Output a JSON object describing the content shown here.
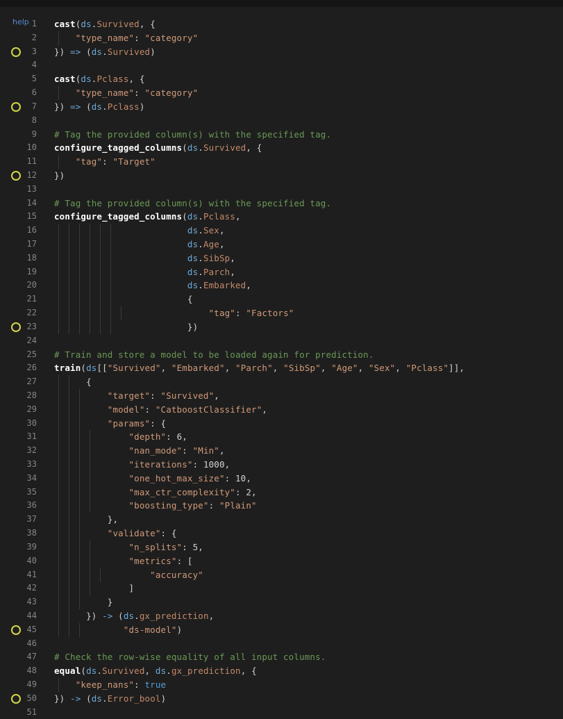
{
  "editor": {
    "help_label": "help",
    "lines": [
      {
        "n": "1",
        "bp": false,
        "t": [
          [
            "f",
            "cast"
          ],
          [
            "o",
            "("
          ],
          [
            "d",
            "ds"
          ],
          [
            "o",
            "."
          ],
          [
            "a",
            "Survived"
          ],
          [
            "o",
            ", {"
          ]
        ]
      },
      {
        "n": "2",
        "bp": false,
        "i": "    ",
        "g": [
          76
        ],
        "t": [
          [
            "k",
            "\"type_name\""
          ],
          [
            "o",
            ": "
          ],
          [
            "s",
            "\"category\""
          ]
        ]
      },
      {
        "n": "3",
        "bp": true,
        "t": [
          [
            "o",
            "}) "
          ],
          [
            "d",
            "=>"
          ],
          [
            "o",
            " ("
          ],
          [
            "d",
            "ds"
          ],
          [
            "o",
            "."
          ],
          [
            "a",
            "Survived"
          ],
          [
            "o",
            ")"
          ]
        ]
      },
      {
        "n": "4",
        "bp": false,
        "t": []
      },
      {
        "n": "5",
        "bp": false,
        "t": [
          [
            "f",
            "cast"
          ],
          [
            "o",
            "("
          ],
          [
            "d",
            "ds"
          ],
          [
            "o",
            "."
          ],
          [
            "a",
            "Pclass"
          ],
          [
            "o",
            ", {"
          ]
        ]
      },
      {
        "n": "6",
        "bp": false,
        "i": "    ",
        "g": [
          76
        ],
        "t": [
          [
            "k",
            "\"type_name\""
          ],
          [
            "o",
            ": "
          ],
          [
            "s",
            "\"category\""
          ]
        ]
      },
      {
        "n": "7",
        "bp": true,
        "t": [
          [
            "o",
            "}) "
          ],
          [
            "d",
            "=>"
          ],
          [
            "o",
            " ("
          ],
          [
            "d",
            "ds"
          ],
          [
            "o",
            "."
          ],
          [
            "a",
            "Pclass"
          ],
          [
            "o",
            ")"
          ]
        ]
      },
      {
        "n": "8",
        "bp": false,
        "t": []
      },
      {
        "n": "9",
        "bp": false,
        "t": [
          [
            "c",
            "# Tag the provided column(s) with the specified tag."
          ]
        ]
      },
      {
        "n": "10",
        "bp": false,
        "t": [
          [
            "f",
            "configure_tagged_columns"
          ],
          [
            "o",
            "("
          ],
          [
            "d",
            "ds"
          ],
          [
            "o",
            "."
          ],
          [
            "a",
            "Survived"
          ],
          [
            "o",
            ", {"
          ]
        ]
      },
      {
        "n": "11",
        "bp": false,
        "i": "    ",
        "g": [
          76
        ],
        "t": [
          [
            "k",
            "\"tag\""
          ],
          [
            "o",
            ": "
          ],
          [
            "s",
            "\"Target\""
          ]
        ]
      },
      {
        "n": "12",
        "bp": true,
        "t": [
          [
            "o",
            "})"
          ]
        ]
      },
      {
        "n": "13",
        "bp": false,
        "t": []
      },
      {
        "n": "14",
        "bp": false,
        "t": [
          [
            "c",
            "# Tag the provided column(s) with the specified tag."
          ]
        ]
      },
      {
        "n": "15",
        "bp": false,
        "t": [
          [
            "f",
            "configure_tagged_columns"
          ],
          [
            "o",
            "("
          ],
          [
            "d",
            "ds"
          ],
          [
            "o",
            "."
          ],
          [
            "a",
            "Pclass"
          ],
          [
            "o",
            ","
          ]
        ]
      },
      {
        "n": "16",
        "bp": false,
        "i": "                         ",
        "g": [
          76,
          91,
          106,
          121,
          136,
          151
        ],
        "t": [
          [
            "d",
            "ds"
          ],
          [
            "o",
            "."
          ],
          [
            "a",
            "Sex"
          ],
          [
            "o",
            ","
          ]
        ]
      },
      {
        "n": "17",
        "bp": false,
        "i": "                         ",
        "g": [
          76,
          91,
          106,
          121,
          136,
          151
        ],
        "t": [
          [
            "d",
            "ds"
          ],
          [
            "o",
            "."
          ],
          [
            "a",
            "Age"
          ],
          [
            "o",
            ","
          ]
        ]
      },
      {
        "n": "18",
        "bp": false,
        "i": "                         ",
        "g": [
          76,
          91,
          106,
          121,
          136,
          151
        ],
        "t": [
          [
            "d",
            "ds"
          ],
          [
            "o",
            "."
          ],
          [
            "a",
            "SibSp"
          ],
          [
            "o",
            ","
          ]
        ]
      },
      {
        "n": "19",
        "bp": false,
        "i": "                         ",
        "g": [
          76,
          91,
          106,
          121,
          136,
          151
        ],
        "t": [
          [
            "d",
            "ds"
          ],
          [
            "o",
            "."
          ],
          [
            "a",
            "Parch"
          ],
          [
            "o",
            ","
          ]
        ]
      },
      {
        "n": "20",
        "bp": false,
        "i": "                         ",
        "g": [
          76,
          91,
          106,
          121,
          136,
          151
        ],
        "t": [
          [
            "d",
            "ds"
          ],
          [
            "o",
            "."
          ],
          [
            "a",
            "Embarked"
          ],
          [
            "o",
            ","
          ]
        ]
      },
      {
        "n": "21",
        "bp": false,
        "i": "                         ",
        "g": [
          76,
          91,
          106,
          121,
          136,
          151
        ],
        "t": [
          [
            "o",
            "{"
          ]
        ]
      },
      {
        "n": "22",
        "bp": false,
        "i": "                             ",
        "g": [
          76,
          91,
          106,
          121,
          136,
          151,
          166
        ],
        "t": [
          [
            "k",
            "\"tag\""
          ],
          [
            "o",
            ": "
          ],
          [
            "s",
            "\"Factors\""
          ]
        ]
      },
      {
        "n": "23",
        "bp": true,
        "i": "                         ",
        "g": [
          76,
          91,
          106,
          121,
          136,
          151
        ],
        "t": [
          [
            "o",
            "})"
          ]
        ]
      },
      {
        "n": "24",
        "bp": false,
        "t": []
      },
      {
        "n": "25",
        "bp": false,
        "t": [
          [
            "c",
            "# Train and store a model to be loaded again for prediction."
          ]
        ]
      },
      {
        "n": "26",
        "bp": false,
        "t": [
          [
            "f",
            "train"
          ],
          [
            "o",
            "("
          ],
          [
            "d",
            "ds"
          ],
          [
            "o",
            "[["
          ],
          [
            "s",
            "\"Survived\""
          ],
          [
            "o",
            ", "
          ],
          [
            "s",
            "\"Embarked\""
          ],
          [
            "o",
            ", "
          ],
          [
            "s",
            "\"Parch\""
          ],
          [
            "o",
            ", "
          ],
          [
            "s",
            "\"SibSp\""
          ],
          [
            "o",
            ", "
          ],
          [
            "s",
            "\"Age\""
          ],
          [
            "o",
            ", "
          ],
          [
            "s",
            "\"Sex\""
          ],
          [
            "o",
            ", "
          ],
          [
            "s",
            "\"Pclass\""
          ],
          [
            "o",
            "]],"
          ]
        ]
      },
      {
        "n": "27",
        "bp": false,
        "i": "      ",
        "g": [
          76,
          91
        ],
        "t": [
          [
            "o",
            "{"
          ]
        ]
      },
      {
        "n": "28",
        "bp": false,
        "i": "          ",
        "g": [
          76,
          91,
          106
        ],
        "t": [
          [
            "k",
            "\"target\""
          ],
          [
            "o",
            ": "
          ],
          [
            "s",
            "\"Survived\""
          ],
          [
            "o",
            ","
          ]
        ]
      },
      {
        "n": "29",
        "bp": false,
        "i": "          ",
        "g": [
          76,
          91,
          106
        ],
        "t": [
          [
            "k",
            "\"model\""
          ],
          [
            "o",
            ": "
          ],
          [
            "s",
            "\"CatboostClassifier\""
          ],
          [
            "o",
            ","
          ]
        ]
      },
      {
        "n": "30",
        "bp": false,
        "i": "          ",
        "g": [
          76,
          91,
          106
        ],
        "t": [
          [
            "k",
            "\"params\""
          ],
          [
            "o",
            ": {"
          ]
        ]
      },
      {
        "n": "31",
        "bp": false,
        "i": "              ",
        "g": [
          76,
          91,
          106,
          121
        ],
        "t": [
          [
            "k",
            "\"depth\""
          ],
          [
            "o",
            ": "
          ],
          [
            "n",
            "6"
          ],
          [
            "o",
            ","
          ]
        ]
      },
      {
        "n": "32",
        "bp": false,
        "i": "              ",
        "g": [
          76,
          91,
          106,
          121
        ],
        "t": [
          [
            "k",
            "\"nan_mode\""
          ],
          [
            "o",
            ": "
          ],
          [
            "s",
            "\"Min\""
          ],
          [
            "o",
            ","
          ]
        ]
      },
      {
        "n": "33",
        "bp": false,
        "i": "              ",
        "g": [
          76,
          91,
          106,
          121
        ],
        "t": [
          [
            "k",
            "\"iterations\""
          ],
          [
            "o",
            ": "
          ],
          [
            "n",
            "1000"
          ],
          [
            "o",
            ","
          ]
        ]
      },
      {
        "n": "34",
        "bp": false,
        "i": "              ",
        "g": [
          76,
          91,
          106,
          121
        ],
        "t": [
          [
            "k",
            "\"one_hot_max_size\""
          ],
          [
            "o",
            ": "
          ],
          [
            "n",
            "10"
          ],
          [
            "o",
            ","
          ]
        ]
      },
      {
        "n": "35",
        "bp": false,
        "i": "              ",
        "g": [
          76,
          91,
          106,
          121
        ],
        "t": [
          [
            "k",
            "\"max_ctr_complexity\""
          ],
          [
            "o",
            ": "
          ],
          [
            "n",
            "2"
          ],
          [
            "o",
            ","
          ]
        ]
      },
      {
        "n": "36",
        "bp": false,
        "i": "              ",
        "g": [
          76,
          91,
          106,
          121
        ],
        "t": [
          [
            "k",
            "\"boosting_type\""
          ],
          [
            "o",
            ": "
          ],
          [
            "s",
            "\"Plain\""
          ]
        ]
      },
      {
        "n": "37",
        "bp": false,
        "i": "          ",
        "g": [
          76,
          91,
          106
        ],
        "t": [
          [
            "o",
            "},"
          ]
        ]
      },
      {
        "n": "38",
        "bp": false,
        "i": "          ",
        "g": [
          76,
          91,
          106
        ],
        "t": [
          [
            "k",
            "\"validate\""
          ],
          [
            "o",
            ": {"
          ]
        ]
      },
      {
        "n": "39",
        "bp": false,
        "i": "              ",
        "g": [
          76,
          91,
          106,
          121
        ],
        "t": [
          [
            "k",
            "\"n_splits\""
          ],
          [
            "o",
            ": "
          ],
          [
            "n",
            "5"
          ],
          [
            "o",
            ","
          ]
        ]
      },
      {
        "n": "40",
        "bp": false,
        "i": "              ",
        "g": [
          76,
          91,
          106,
          121
        ],
        "t": [
          [
            "k",
            "\"metrics\""
          ],
          [
            "o",
            ": ["
          ]
        ]
      },
      {
        "n": "41",
        "bp": false,
        "i": "                  ",
        "g": [
          76,
          91,
          106,
          121,
          136
        ],
        "t": [
          [
            "s",
            "\"accuracy\""
          ]
        ]
      },
      {
        "n": "42",
        "bp": false,
        "i": "              ",
        "g": [
          76,
          91,
          106,
          121
        ],
        "t": [
          [
            "o",
            "]"
          ]
        ]
      },
      {
        "n": "43",
        "bp": false,
        "i": "          ",
        "g": [
          76,
          91,
          106
        ],
        "t": [
          [
            "o",
            "}"
          ]
        ]
      },
      {
        "n": "44",
        "bp": false,
        "i": "      ",
        "g": [
          76,
          91
        ],
        "t": [
          [
            "o",
            "}) "
          ],
          [
            "d",
            "->"
          ],
          [
            "o",
            " ("
          ],
          [
            "d",
            "ds"
          ],
          [
            "o",
            "."
          ],
          [
            "a",
            "gx_prediction"
          ],
          [
            "o",
            ","
          ]
        ]
      },
      {
        "n": "45",
        "bp": true,
        "i": "             ",
        "g": [
          76,
          91,
          106
        ],
        "t": [
          [
            "s",
            "\"ds-model\""
          ],
          [
            "o",
            ")"
          ]
        ]
      },
      {
        "n": "46",
        "bp": false,
        "t": []
      },
      {
        "n": "47",
        "bp": false,
        "t": [
          [
            "c",
            "# Check the row-wise equality of all input columns."
          ]
        ]
      },
      {
        "n": "48",
        "bp": false,
        "t": [
          [
            "f",
            "equal"
          ],
          [
            "o",
            "("
          ],
          [
            "d",
            "ds"
          ],
          [
            "o",
            "."
          ],
          [
            "a",
            "Survived"
          ],
          [
            "o",
            ", "
          ],
          [
            "d",
            "ds"
          ],
          [
            "o",
            "."
          ],
          [
            "a",
            "gx_prediction"
          ],
          [
            "o",
            ", {"
          ]
        ]
      },
      {
        "n": "49",
        "bp": false,
        "i": "    ",
        "g": [
          76
        ],
        "t": [
          [
            "k",
            "\"keep_nans\""
          ],
          [
            "o",
            ": "
          ],
          [
            "kw",
            "true"
          ]
        ]
      },
      {
        "n": "50",
        "bp": true,
        "t": [
          [
            "o",
            "}) "
          ],
          [
            "d",
            "->"
          ],
          [
            "o",
            " ("
          ],
          [
            "d",
            "ds"
          ],
          [
            "o",
            "."
          ],
          [
            "a",
            "Error_bool"
          ],
          [
            "o",
            ")"
          ]
        ]
      },
      {
        "n": "51",
        "bp": false,
        "t": []
      }
    ]
  }
}
